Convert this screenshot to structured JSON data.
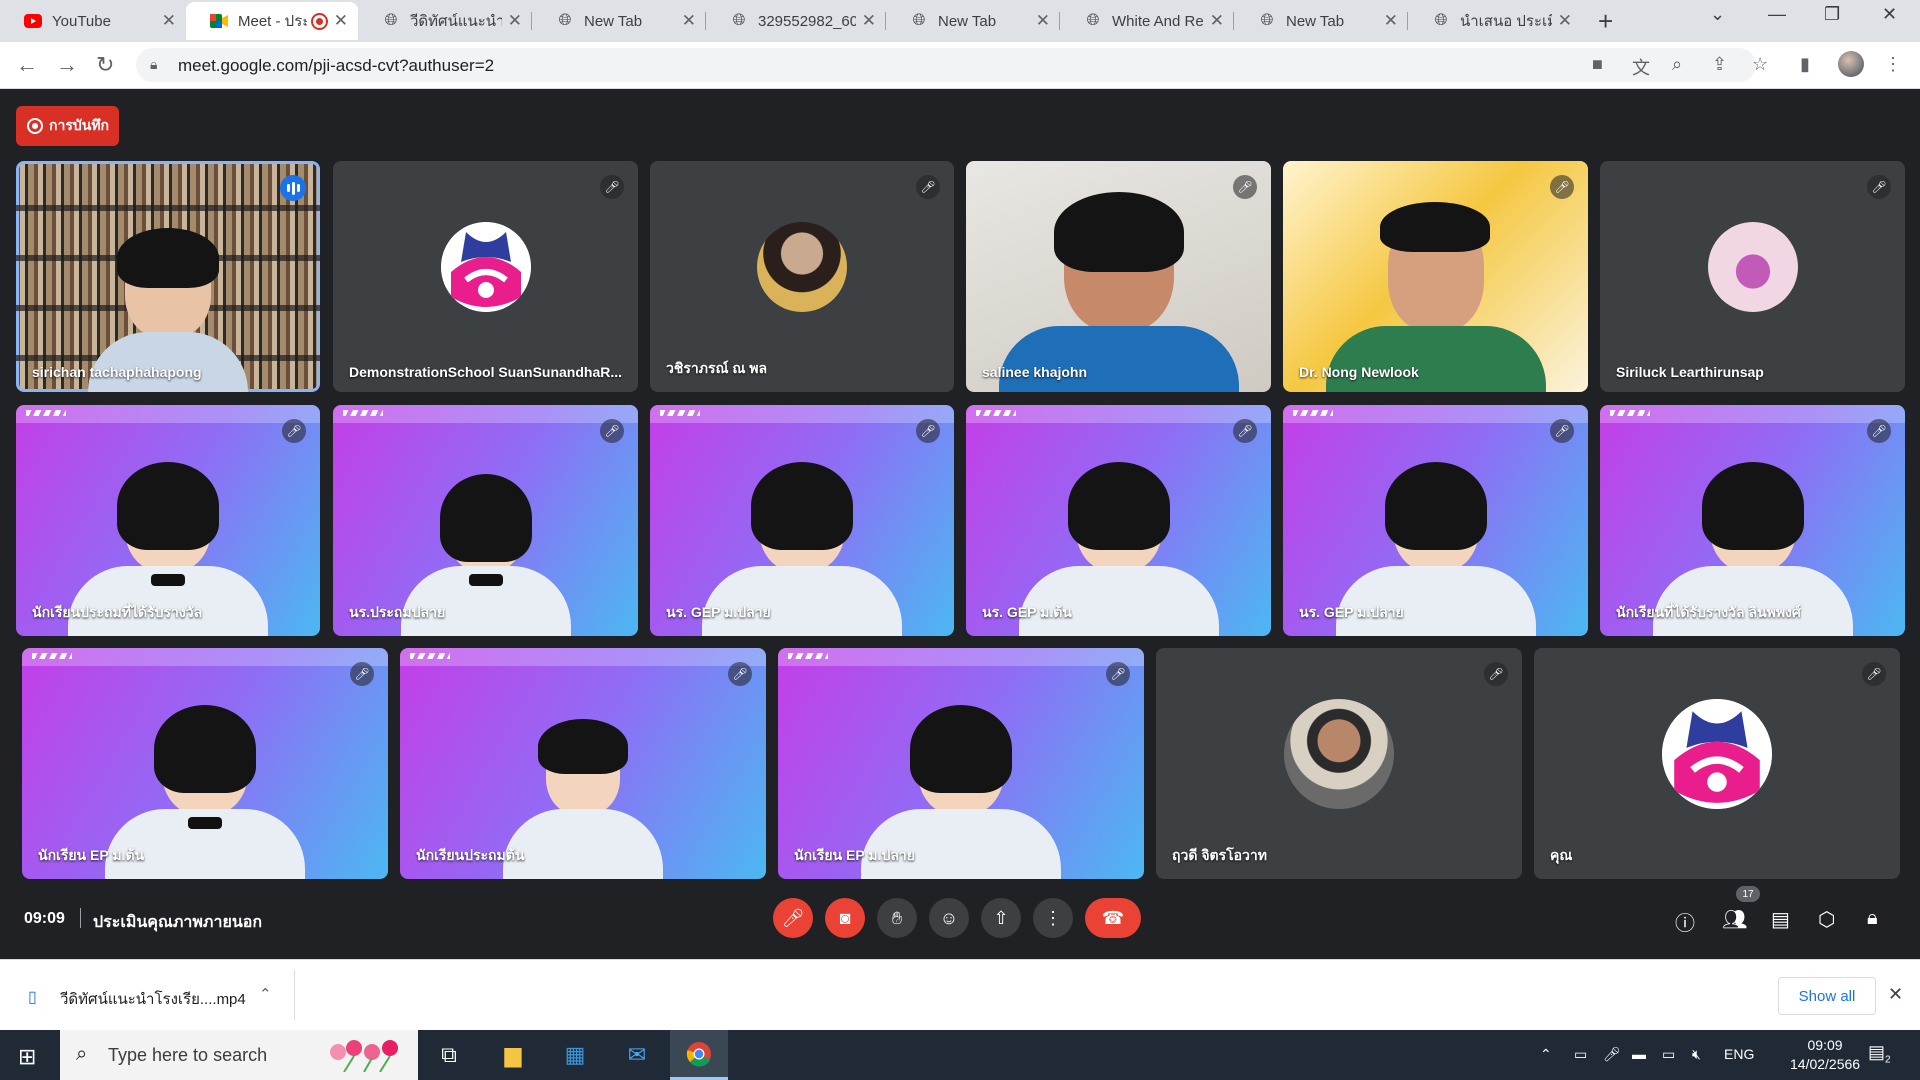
{
  "browser": {
    "tabs": [
      {
        "title": "YouTube",
        "icon": "youtube-icon",
        "active": false
      },
      {
        "title": "Meet - ประ",
        "icon": "meet-icon",
        "active": true
      },
      {
        "title": "วีดิทัศน์แนะนำโร",
        "icon": "globe-icon",
        "active": false
      },
      {
        "title": "New Tab",
        "icon": "globe-icon",
        "active": false
      },
      {
        "title": "329552982_60",
        "icon": "globe-icon",
        "active": false
      },
      {
        "title": "New Tab",
        "icon": "globe-icon",
        "active": false
      },
      {
        "title": "White And Re",
        "icon": "globe-icon",
        "active": false
      },
      {
        "title": "New Tab",
        "icon": "globe-icon",
        "active": false
      },
      {
        "title": "นำเสนอ ประเมิน",
        "icon": "globe-icon",
        "active": false
      }
    ],
    "url": "meet.google.com/pji-acsd-cvt?authuser=2"
  },
  "meet": {
    "recording_label": "การบันทึก",
    "clock": "09:09",
    "meeting_title": "ประเมินคุณภาพภายนอก",
    "participant_count": "17",
    "participants": [
      {
        "name": "sirichan tachaphahapong",
        "state": "speaking",
        "view": "video-books"
      },
      {
        "name": "DemonstrationSchool SuanSunandhaR...",
        "state": "muted",
        "view": "avatar-logo"
      },
      {
        "name": "วชิราภรณ์ ณ พล",
        "state": "muted",
        "view": "avatar-photo"
      },
      {
        "name": "salinee khajohn",
        "state": "muted",
        "view": "video-wall"
      },
      {
        "name": "Dr. Nong Newlook",
        "state": "muted",
        "view": "video-gold"
      },
      {
        "name": "Siriluck Learthirunsap",
        "state": "muted",
        "view": "avatar-cartoon"
      },
      {
        "name": "นักเรียนประถมที่ได้รับรางวัล",
        "state": "muted",
        "view": "video-purple"
      },
      {
        "name": "นร.ประถมปลาย",
        "state": "muted",
        "view": "video-purple"
      },
      {
        "name": "นร. GEP ม.ปลาย",
        "state": "muted",
        "view": "video-purple"
      },
      {
        "name": "นร. GEP ม.ต้น",
        "state": "muted",
        "view": "video-purple"
      },
      {
        "name": "นร. GEP ม.ปลาย",
        "state": "muted",
        "view": "video-purple"
      },
      {
        "name": "นักเรียนที่ได้รับรางวัล ลินพพงศ์",
        "state": "muted",
        "view": "video-purple"
      },
      {
        "name": "นักเรียน EP ม.ต้น",
        "state": "muted",
        "view": "video-purple"
      },
      {
        "name": "นักเรียนประถมต้น",
        "state": "muted",
        "view": "video-purple"
      },
      {
        "name": "นักเรียน EP ม.ปลาย",
        "state": "muted",
        "view": "video-purple"
      },
      {
        "name": "ฤวดี จิตรโอวาท",
        "state": "muted",
        "view": "avatar-photo-uniform"
      },
      {
        "name": "คุณ",
        "state": "muted",
        "view": "avatar-logo"
      }
    ]
  },
  "download": {
    "filename": "วีดิทัศน์แนะนำโรงเรีย....mp4",
    "show_all": "Show all"
  },
  "taskbar": {
    "search_placeholder": "Type here to search",
    "lang": "ENG",
    "time": "09:09",
    "date": "14/02/2566",
    "notification_count": "2"
  },
  "colors": {
    "meet_bg": "#202124",
    "tile_bg": "#3c4043",
    "record_red": "#d93025",
    "end_call_red": "#ea4335",
    "speaking_blue": "#8ab4f8"
  }
}
